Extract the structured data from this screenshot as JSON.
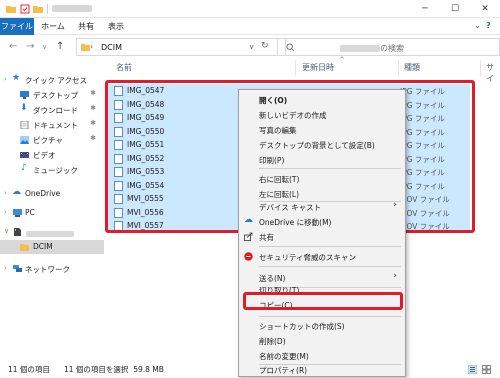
{
  "colors": {
    "accent": "#1a6fc1",
    "selection": "#cce8ff",
    "highlight": "#e01b2b"
  },
  "ribbon": {
    "tabs": [
      "ファイル",
      "ホーム",
      "共有",
      "表示"
    ]
  },
  "address": {
    "path": "DCIM"
  },
  "search": {
    "placeholder_suffix": "の検索"
  },
  "columns": [
    "名前",
    "更新日時",
    "種類",
    "サイ"
  ],
  "sidebar": {
    "quick_access": "クイック アクセス",
    "items": [
      "デスクトップ",
      "ダウンロード",
      "ドキュメント",
      "ピクチャ",
      "ビデオ",
      "ミュージック"
    ],
    "onedrive": "OneDrive",
    "pc": "PC",
    "dcim": "DCIM",
    "network": "ネットワーク"
  },
  "files": [
    {
      "name": "IMG_0547",
      "type": "JPG ファイル"
    },
    {
      "name": "IMG_0548",
      "type": "JPG ファイル"
    },
    {
      "name": "IMG_0549",
      "type": "JPG ファイル"
    },
    {
      "name": "IMG_0550",
      "type": "JPG ファイル"
    },
    {
      "name": "IMG_0551",
      "type": "JPG ファイル"
    },
    {
      "name": "IMG_0552",
      "type": "JPG ファイル"
    },
    {
      "name": "IMG_0553",
      "type": "JPG ファイル"
    },
    {
      "name": "IMG_0554",
      "type": "JPG ファイル"
    },
    {
      "name": "MVI_0555",
      "type": "MOV ファイル"
    },
    {
      "name": "MVI_0556",
      "type": "MOV ファイル"
    },
    {
      "name": "MVI_0557",
      "type": "MOV ファイル"
    }
  ],
  "context_menu": {
    "open": "開く(O)",
    "new_video": "新しいビデオの作成",
    "edit_photo": "写真の編集",
    "set_background": "デスクトップの背景として設定(B)",
    "print": "印刷(P)",
    "rotate_right": "右に回転(T)",
    "rotate_left": "左に回転(L)",
    "device_cast": "デバイス キャスト",
    "move_onedrive": "OneDrive に移動(M)",
    "share": "共有",
    "security_scan": "セキュリティ脅威のスキャン",
    "send_to": "送る(N)",
    "cut": "切り取り(T)",
    "copy": "コピー(C)",
    "create_shortcut": "ショートカットの作成(S)",
    "delete": "削除(D)",
    "rename": "名前の変更(M)",
    "properties": "プロパティ(R)"
  },
  "status": {
    "count": "11 個の項目",
    "selected": "11 個の項目を選択  59.8 MB"
  }
}
